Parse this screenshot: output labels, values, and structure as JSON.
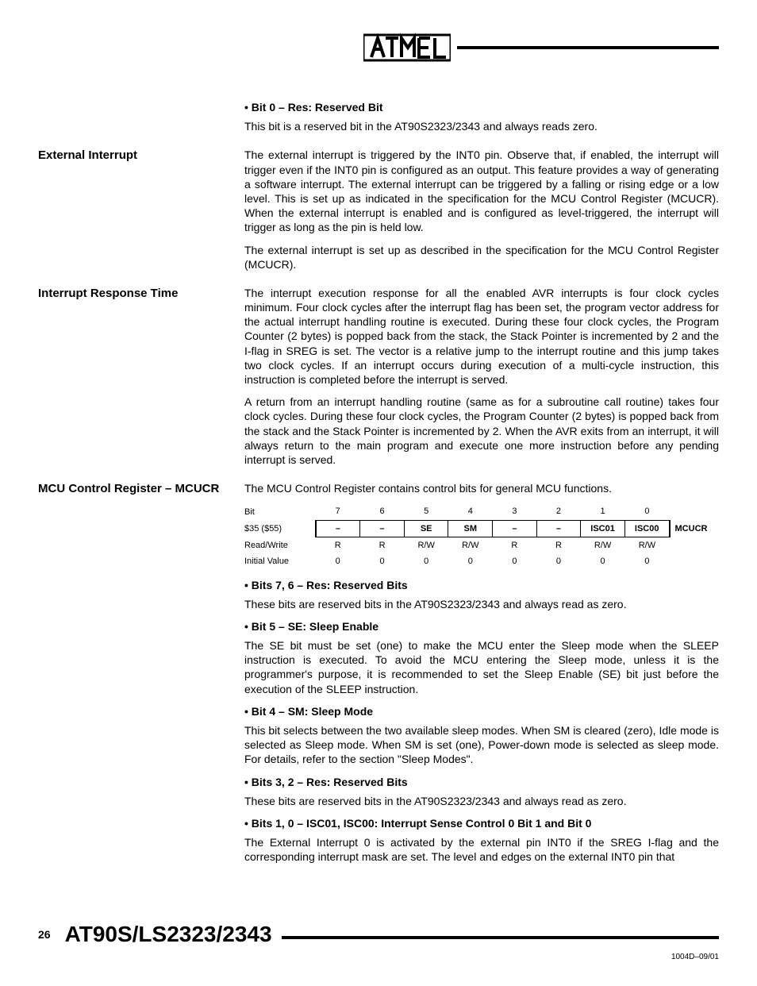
{
  "header": {
    "brand": "ATMEL"
  },
  "sections": [
    {
      "heading": "",
      "blocks": [
        {
          "type": "bullet",
          "text": "Bit 0 – Res: Reserved Bit"
        },
        {
          "type": "para",
          "text": "This bit is a reserved bit in the AT90S2323/2343 and always reads zero."
        }
      ]
    },
    {
      "heading": "External Interrupt",
      "blocks": [
        {
          "type": "para",
          "text": "The external interrupt is triggered by the INT0 pin. Observe that, if enabled, the interrupt will trigger even if the INT0 pin is configured as an output. This feature provides a way of generating a software interrupt. The external interrupt can be triggered by a falling or rising edge or a low level. This is set up as indicated in the specification for the MCU Control Register (MCUCR). When the external interrupt is enabled and is configured as level-triggered, the interrupt will trigger as long as the pin is held low."
        },
        {
          "type": "para",
          "text": "The external interrupt is set up as described in the specification for the MCU Control Register (MCUCR)."
        }
      ]
    },
    {
      "heading": "Interrupt Response Time",
      "blocks": [
        {
          "type": "para",
          "text": "The interrupt execution response for all the enabled AVR interrupts is four clock cycles minimum. Four clock cycles after the interrupt flag has been set, the program vector address for the actual interrupt handling routine is executed. During these four clock cycles, the Program Counter (2 bytes) is popped back from the stack, the Stack Pointer is incremented by 2 and the I-flag in SREG is set. The vector is a relative jump to the interrupt routine and this jump takes two clock cycles. If an interrupt occurs during execution of a multi-cycle instruction, this instruction is completed before the interrupt is served."
        },
        {
          "type": "para",
          "text": "A return from an interrupt handling routine (same as for a subroutine call routine) takes four clock cycles. During these four clock cycles, the Program Counter (2 bytes) is popped back from the stack and the Stack Pointer is incremented by 2. When the AVR exits from an interrupt, it will always return to the main program and execute one more instruction before any pending interrupt is served."
        }
      ]
    },
    {
      "heading": "MCU Control Register – MCUCR",
      "blocks": [
        {
          "type": "para",
          "text": "The MCU Control Register contains control bits for general MCU functions."
        },
        {
          "type": "regtable"
        },
        {
          "type": "bullet",
          "text": "Bits 7, 6 – Res: Reserved Bits"
        },
        {
          "type": "para",
          "text": "These bits are reserved bits in the AT90S2323/2343 and always read as zero."
        },
        {
          "type": "bullet",
          "text": "Bit 5 – SE: Sleep Enable"
        },
        {
          "type": "para",
          "text": "The SE bit must be set (one) to make the MCU enter the Sleep mode when the SLEEP instruction is executed. To avoid the MCU entering the Sleep mode, unless it is the programmer's purpose, it is recommended to set the Sleep Enable (SE) bit just before the execution of the SLEEP instruction."
        },
        {
          "type": "bullet",
          "text": "Bit 4 – SM: Sleep Mode"
        },
        {
          "type": "para",
          "text": "This bit selects between the two available sleep modes. When SM is cleared (zero), Idle mode is selected as Sleep mode. When SM is set (one), Power-down mode is selected as sleep mode. For details, refer to the section \"Sleep Modes\"."
        },
        {
          "type": "bullet",
          "text": "Bits 3, 2 – Res: Reserved Bits"
        },
        {
          "type": "para",
          "text": "These bits are reserved bits in the AT90S2323/2343 and always read as zero."
        },
        {
          "type": "bullet",
          "text": "Bits 1, 0 – ISC01, ISC00: Interrupt Sense Control 0 Bit 1 and Bit 0"
        },
        {
          "type": "para",
          "text": "The External Interrupt 0 is activated by the external pin INT0 if the SREG I-flag and the corresponding interrupt mask are set. The level and edges on the external INT0 pin that"
        }
      ]
    }
  ],
  "register_table": {
    "name": "MCUCR",
    "rows": {
      "bit_label": "Bit",
      "bits": [
        "7",
        "6",
        "5",
        "4",
        "3",
        "2",
        "1",
        "0"
      ],
      "addr_label": "$35 ($55)",
      "names": [
        "–",
        "–",
        "SE",
        "SM",
        "–",
        "–",
        "ISC01",
        "ISC00"
      ],
      "rw_label": "Read/Write",
      "rw": [
        "R",
        "R",
        "R/W",
        "R/W",
        "R",
        "R",
        "R/W",
        "R/W"
      ],
      "init_label": "Initial Value",
      "init": [
        "0",
        "0",
        "0",
        "0",
        "0",
        "0",
        "0",
        "0"
      ]
    }
  },
  "footer": {
    "page": "26",
    "title": "AT90S/LS2323/2343",
    "docnum": "1004D–09/01"
  }
}
